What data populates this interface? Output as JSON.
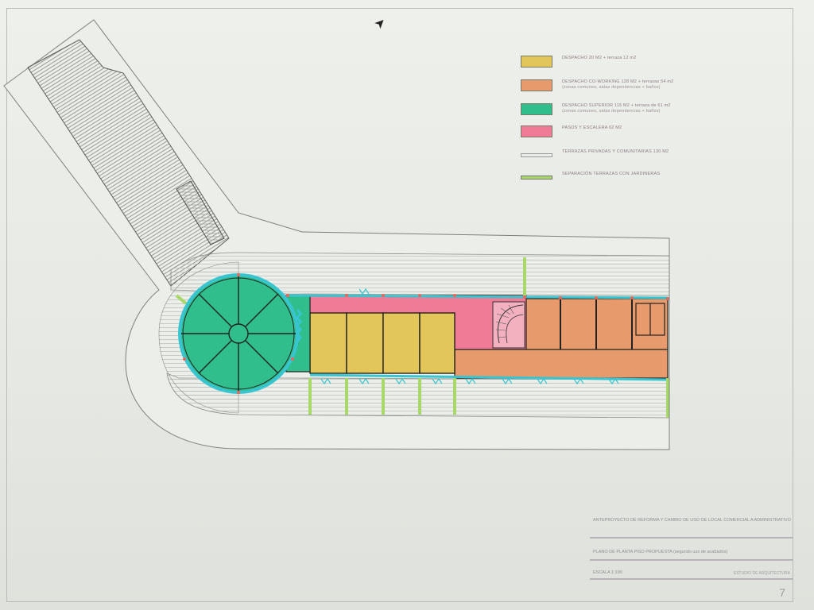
{
  "legend": [
    {
      "label": "DESPACHO 20 M2 + terraza 12 m2",
      "sub": "",
      "color": "#e3c65a",
      "kind": "fill"
    },
    {
      "label": "DESPACHO CO-WORKING 128 M2 + terrazas 54 m2",
      "sub": "(zonas comunes, salas dependencias + baños)",
      "color": "#e79a6b",
      "kind": "fill"
    },
    {
      "label": "DESPACHO SUPERIOR 115 M2 + terraza de 61 m2",
      "sub": "(zonas comunes, salas dependencias + baños)",
      "color": "#2fbe8c",
      "kind": "fill"
    },
    {
      "label": "PASOS Y ESCALERA 62 M2",
      "sub": "",
      "color": "#f07b96",
      "kind": "fill"
    },
    {
      "label": "TERRAZAS PRIVADAS Y COMUNITARIAS 130 M2",
      "sub": "",
      "color": "#9a9a9a",
      "kind": "hollow"
    },
    {
      "label": "SEPARACIÓN TERRAZAS CON JARDINERAS",
      "sub": "",
      "color": "#a9d86a",
      "kind": "line"
    }
  ],
  "title_block": {
    "project": "ANTEPROYECTO DE REFORMA Y CAMBIO DE USO DE LOCAL COMERCIAL A ADMINISTRATIVO",
    "plan": "PLANO DE PLANTA PISO PROPUESTA (segundo uso de acabados)",
    "scale": "ESCALA 1:100",
    "date": "ESTUDIO DE ARQUITECTURA",
    "page": "7"
  },
  "colors": {
    "yellow": "#e3c65a",
    "orange": "#e79a6b",
    "green": "#2fbe8c",
    "pink": "#f07b96",
    "cyan": "#38c5d0",
    "lime": "#a9d86a"
  }
}
